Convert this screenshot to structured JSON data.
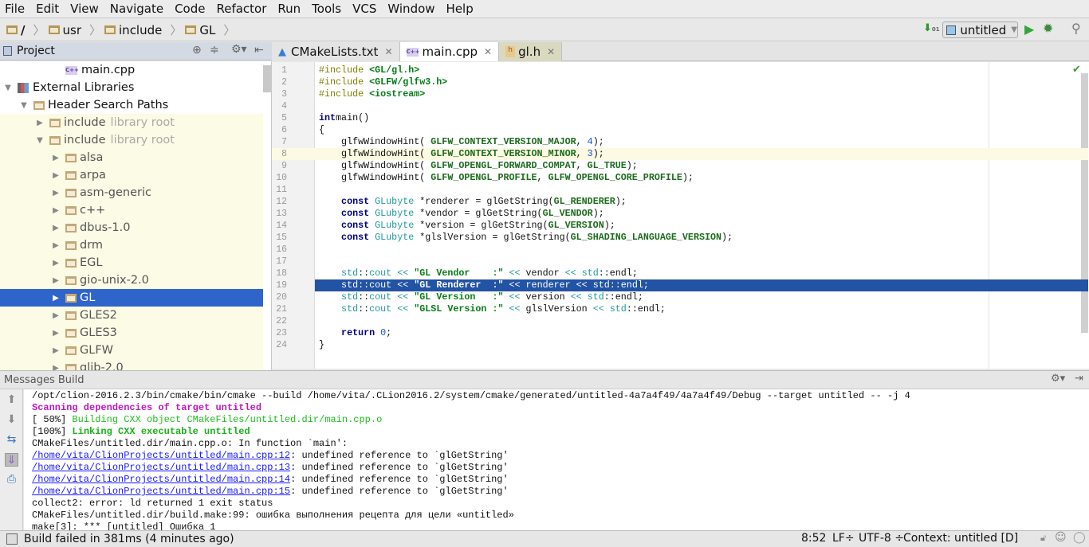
{
  "menu": [
    "File",
    "Edit",
    "View",
    "Navigate",
    "Code",
    "Refactor",
    "Run",
    "Tools",
    "VCS",
    "Window",
    "Help"
  ],
  "breadcrumb": [
    "/",
    "usr",
    "include",
    "GL"
  ],
  "run_config": "untitled",
  "project_panel": {
    "title": "Project"
  },
  "tree": [
    {
      "label": "main.cpp",
      "indent": 3,
      "arrow": "",
      "icon": "cpp"
    },
    {
      "label": "External Libraries",
      "indent": 0,
      "arrow": "▼",
      "icon": "lib"
    },
    {
      "label": "Header Search Paths",
      "indent": 1,
      "arrow": "▼",
      "icon": "folder"
    },
    {
      "label": "include",
      "suffix": "library root",
      "indent": 2,
      "arrow": "▶",
      "icon": "folder",
      "lib": true
    },
    {
      "label": "include",
      "suffix": "library root",
      "indent": 2,
      "arrow": "▼",
      "icon": "folder",
      "lib": true
    },
    {
      "label": "alsa",
      "indent": 3,
      "arrow": "▶",
      "icon": "folder",
      "lib": true
    },
    {
      "label": "arpa",
      "indent": 3,
      "arrow": "▶",
      "icon": "folder",
      "lib": true
    },
    {
      "label": "asm-generic",
      "indent": 3,
      "arrow": "▶",
      "icon": "folder",
      "lib": true
    },
    {
      "label": "c++",
      "indent": 3,
      "arrow": "▶",
      "icon": "folder",
      "lib": true
    },
    {
      "label": "dbus-1.0",
      "indent": 3,
      "arrow": "▶",
      "icon": "folder",
      "lib": true
    },
    {
      "label": "drm",
      "indent": 3,
      "arrow": "▶",
      "icon": "folder",
      "lib": true
    },
    {
      "label": "EGL",
      "indent": 3,
      "arrow": "▶",
      "icon": "folder",
      "lib": true
    },
    {
      "label": "gio-unix-2.0",
      "indent": 3,
      "arrow": "▶",
      "icon": "folder",
      "lib": true
    },
    {
      "label": "GL",
      "indent": 3,
      "arrow": "▶",
      "icon": "folder",
      "lib": true,
      "selected": true
    },
    {
      "label": "GLES2",
      "indent": 3,
      "arrow": "▶",
      "icon": "folder",
      "lib": true
    },
    {
      "label": "GLES3",
      "indent": 3,
      "arrow": "▶",
      "icon": "folder",
      "lib": true
    },
    {
      "label": "GLFW",
      "indent": 3,
      "arrow": "▶",
      "icon": "folder",
      "lib": true
    },
    {
      "label": "glib-2.0",
      "indent": 3,
      "arrow": "▶",
      "icon": "folder",
      "lib": true
    }
  ],
  "tabs": [
    {
      "label": "CMakeLists.txt",
      "icon": "cmake"
    },
    {
      "label": "main.cpp",
      "icon": "cpp",
      "active": true
    },
    {
      "label": "gl.h",
      "icon": "header"
    }
  ],
  "code": [
    [
      [
        "pp",
        "#include "
      ],
      [
        "str",
        "<GL/gl.h>"
      ]
    ],
    [
      [
        "pp",
        "#include "
      ],
      [
        "str",
        "<GLFW/glfw3.h>"
      ]
    ],
    [
      [
        "pp",
        "#include "
      ],
      [
        "str",
        "<iostream>"
      ]
    ],
    [],
    [
      [
        "kw",
        "int"
      ],
      [
        "",
        "main()"
      ]
    ],
    [
      [
        "",
        "{"
      ]
    ],
    [
      [
        "",
        "    glfwWindowHint( "
      ],
      [
        "mac",
        "GLFW_CONTEXT_VERSION_MAJOR"
      ],
      [
        "",
        ", "
      ],
      [
        "num",
        "4"
      ],
      [
        "",
        ");"
      ]
    ],
    [
      [
        "",
        "    glfwWindowHint( "
      ],
      [
        "mac",
        "GLFW_CONTEXT_VERSION_MINOR"
      ],
      [
        "",
        ", "
      ],
      [
        "num",
        "3"
      ],
      [
        "",
        ");"
      ]
    ],
    [
      [
        "",
        "    glfwWindowHint( "
      ],
      [
        "mac",
        "GLFW_OPENGL_FORWARD_COMPAT"
      ],
      [
        "",
        ", "
      ],
      [
        "mac",
        "GL_TRUE"
      ],
      [
        "",
        ");"
      ]
    ],
    [
      [
        "",
        "    glfwWindowHint( "
      ],
      [
        "mac",
        "GLFW_OPENGL_PROFILE"
      ],
      [
        "",
        ", "
      ],
      [
        "mac",
        "GLFW_OPENGL_CORE_PROFILE"
      ],
      [
        "",
        ");"
      ]
    ],
    [],
    [
      [
        "kw",
        "    const "
      ],
      [
        "ty",
        "GLubyte"
      ],
      [
        "",
        " *renderer = glGetString("
      ],
      [
        "mac",
        "GL_RENDERER"
      ],
      [
        "",
        ");"
      ]
    ],
    [
      [
        "kw",
        "    const "
      ],
      [
        "ty",
        "GLubyte"
      ],
      [
        "",
        " *vendor = glGetString("
      ],
      [
        "mac",
        "GL_VENDOR"
      ],
      [
        "",
        ");"
      ]
    ],
    [
      [
        "kw",
        "    const "
      ],
      [
        "ty",
        "GLubyte"
      ],
      [
        "",
        " *version = glGetString("
      ],
      [
        "mac",
        "GL_VERSION"
      ],
      [
        "",
        ");"
      ]
    ],
    [
      [
        "kw",
        "    const "
      ],
      [
        "ty",
        "GLubyte"
      ],
      [
        "",
        " *glslVersion = glGetString("
      ],
      [
        "mac",
        "GL_SHADING_LANGUAGE_VERSION"
      ],
      [
        "",
        ");"
      ]
    ],
    [],
    [],
    [
      [
        "ns",
        "    std"
      ],
      [
        "",
        "::"
      ],
      [
        "ns",
        "cout"
      ],
      [
        "ty",
        " << "
      ],
      [
        "str",
        "\"GL Vendor    :\""
      ],
      [
        "ty",
        " << "
      ],
      [
        "",
        "vendor"
      ],
      [
        "ty",
        " << "
      ],
      [
        "ns",
        "std"
      ],
      [
        "",
        "::endl;"
      ]
    ],
    [
      [
        "ns",
        "    std"
      ],
      [
        "",
        "::"
      ],
      [
        "ns",
        "cout"
      ],
      [
        "ty",
        " << "
      ],
      [
        "str",
        "\"GL Renderer  :\""
      ],
      [
        "ty",
        " << "
      ],
      [
        "",
        "renderer"
      ],
      [
        "ty",
        " << "
      ],
      [
        "ns",
        "std"
      ],
      [
        "",
        "::endl;"
      ]
    ],
    [
      [
        "ns",
        "    std"
      ],
      [
        "",
        "::"
      ],
      [
        "ns",
        "cout"
      ],
      [
        "ty",
        " << "
      ],
      [
        "str",
        "\"GL Version   :\""
      ],
      [
        "ty",
        " << "
      ],
      [
        "",
        "version"
      ],
      [
        "ty",
        " << "
      ],
      [
        "ns",
        "std"
      ],
      [
        "",
        "::endl;"
      ]
    ],
    [
      [
        "ns",
        "    std"
      ],
      [
        "",
        "::"
      ],
      [
        "ns",
        "cout"
      ],
      [
        "ty",
        " << "
      ],
      [
        "str",
        "\"GLSL Version :\""
      ],
      [
        "ty",
        " << "
      ],
      [
        "",
        "glslVersion"
      ],
      [
        "ty",
        " << "
      ],
      [
        "ns",
        "std"
      ],
      [
        "",
        "::endl;"
      ]
    ],
    [],
    [
      [
        "kw",
        "    return "
      ],
      [
        "num",
        "0"
      ],
      [
        "",
        ";"
      ]
    ],
    [
      [
        "",
        "}"
      ]
    ]
  ],
  "caret_line": 8,
  "selected_line": 19,
  "messages": {
    "title": "Messages Build",
    "lines": [
      [
        [
          "",
          "/opt/clion-2016.2.3/bin/cmake/bin/cmake --build /home/vita/.CLion2016.2/system/cmake/generated/untitled-4a7a4f49/4a7a4f49/Debug --target untitled -- -j 4"
        ]
      ],
      [
        [
          "mag",
          "Scanning dependencies of target untitled"
        ]
      ],
      [
        [
          "",
          "[ 50%] "
        ],
        [
          "grn",
          "Building CXX object CMakeFiles/untitled.dir/main.cpp.o"
        ]
      ],
      [
        [
          "",
          "[100%] "
        ],
        [
          "grnb",
          "Linking CXX executable untitled"
        ]
      ],
      [
        [
          "",
          "CMakeFiles/untitled.dir/main.cpp.o: In function `main':"
        ]
      ],
      [
        [
          "lnk",
          "/home/vita/ClionProjects/untitled/main.cpp:12"
        ],
        [
          "",
          ": undefined reference to `glGetString'"
        ]
      ],
      [
        [
          "lnk",
          "/home/vita/ClionProjects/untitled/main.cpp:13"
        ],
        [
          "",
          ": undefined reference to `glGetString'"
        ]
      ],
      [
        [
          "lnk",
          "/home/vita/ClionProjects/untitled/main.cpp:14"
        ],
        [
          "",
          ": undefined reference to `glGetString'"
        ]
      ],
      [
        [
          "lnk",
          "/home/vita/ClionProjects/untitled/main.cpp:15"
        ],
        [
          "",
          ": undefined reference to `glGetString'"
        ]
      ],
      [
        [
          "",
          "collect2: error: ld returned 1 exit status"
        ]
      ],
      [
        [
          "",
          "CMakeFiles/untitled.dir/build.make:99: ошибка выполнения рецепта для цели «untitled»"
        ]
      ],
      [
        [
          "",
          "make[3]: *** [untitled] Ошибка 1"
        ]
      ]
    ]
  },
  "status": {
    "text": "Build failed in 381ms (4 minutes ago)",
    "position": "8:52",
    "line_sep": "LF÷",
    "encoding": "UTF-8 ÷",
    "context": "Context: untitled [D]"
  }
}
